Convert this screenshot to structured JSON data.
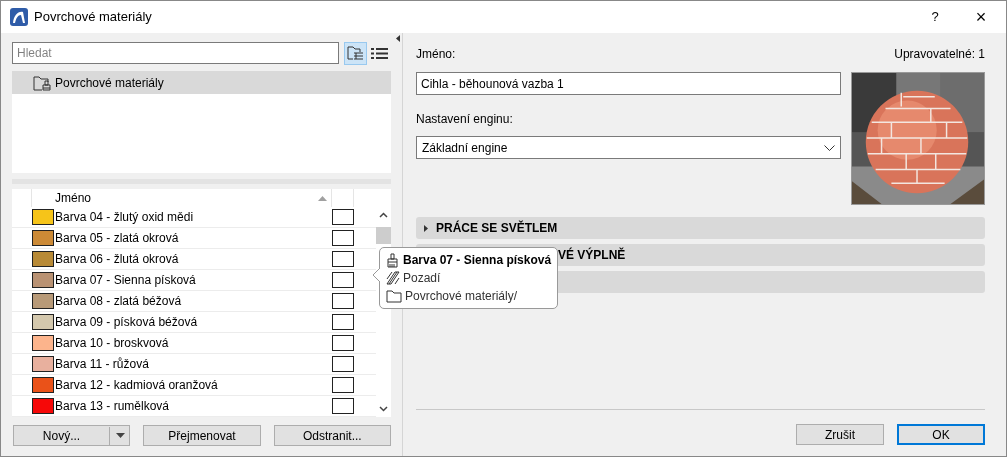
{
  "window": {
    "title": "Povrchové materiály",
    "help": "?",
    "close": "×"
  },
  "search": {
    "placeholder": "Hledat"
  },
  "view_buttons": [
    {
      "kind": "tree",
      "selected": true
    },
    {
      "kind": "list",
      "selected": false
    }
  ],
  "tree": [
    {
      "label": "Povrchové materiály",
      "selected": true
    }
  ],
  "table": {
    "columns": [
      "Jméno"
    ],
    "rows": [
      {
        "name": "Barva 04 - žlutý oxid mědi",
        "color": "#f6c419",
        "checked": false
      },
      {
        "name": "Barva 05 - zlatá okrová",
        "color": "#cc8a36",
        "checked": false
      },
      {
        "name": "Barva 06 - žlutá okrová",
        "color": "#b88a36",
        "checked": false
      },
      {
        "name": "Barva 07 - Sienna písková",
        "color": "#b99273",
        "checked": false
      },
      {
        "name": "Barva 08 - zlatá béžová",
        "color": "#b89a78",
        "checked": false
      },
      {
        "name": "Barva 09 - písková béžová",
        "color": "#d4c8ad",
        "checked": false
      },
      {
        "name": "Barva 10 - broskvová",
        "color": "#fcb48c",
        "checked": false
      },
      {
        "name": "Barva 11 - růžová",
        "color": "#e8b09e",
        "checked": false
      },
      {
        "name": "Barva 12 - kadmiová oranžová",
        "color": "#ea5219",
        "checked": false
      },
      {
        "name": "Barva 13 - rumělková",
        "color": "#f60808",
        "checked": false
      }
    ]
  },
  "left_buttons": [
    "Nový...",
    "Přejmenovat",
    "Odstranit..."
  ],
  "name_label": "Jméno:",
  "editable": "Upravovatelné: 1",
  "name_value": "Cihla - běhounová vazba 1",
  "engine_label": "Nastavení enginu:",
  "engine_value": "Základní engine",
  "sections": [
    {
      "kind": "section",
      "title": "PRÁCE SE SVĚTLEM",
      "covered": false
    },
    {
      "kind": "section",
      "title": "VÉ VÝPLNĚ",
      "covered": true
    },
    {
      "kind": "section"
    }
  ],
  "tooltip": [
    {
      "kind": "brush",
      "text": "Barva 07 - Sienna písková",
      "bold": true
    },
    {
      "kind": "hatch",
      "text": "Pozadí",
      "bold": false
    },
    {
      "kind": "folder",
      "text": "Povrchové materiály/",
      "bold": false
    }
  ],
  "buttons": [
    {
      "label": "Zrušit",
      "default": false
    },
    {
      "label": "OK",
      "default": true
    }
  ]
}
